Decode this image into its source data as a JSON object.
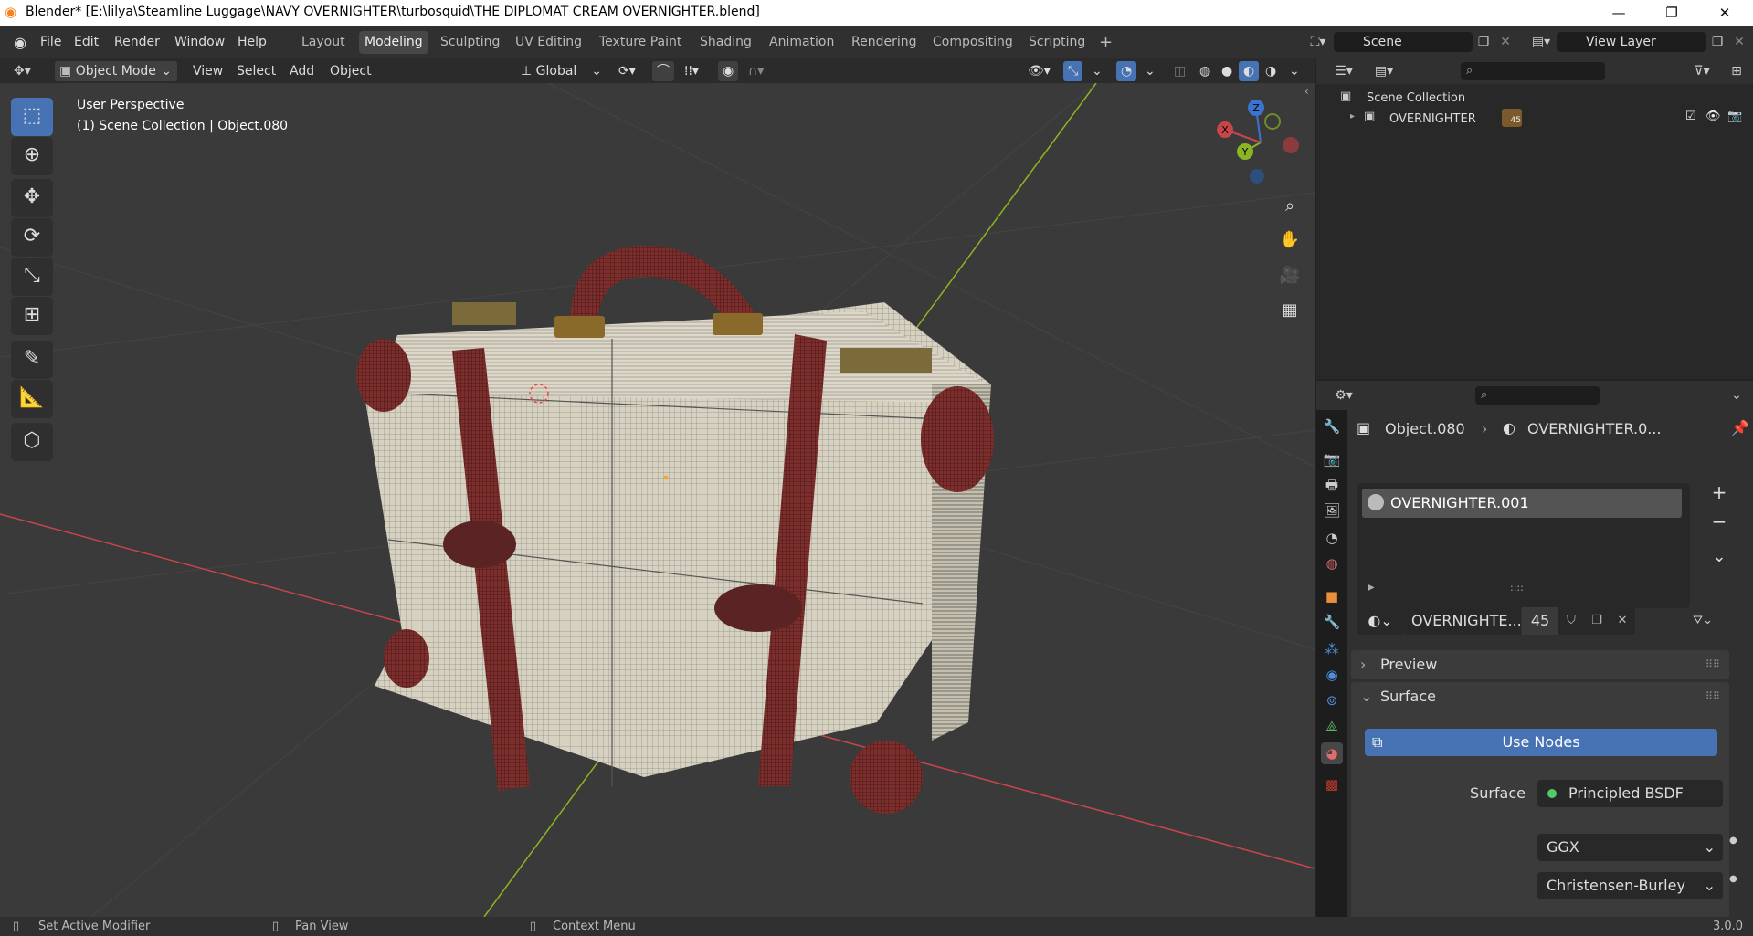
{
  "window": {
    "title": "Blender* [E:\\lilya\\Steamline Luggage\\NAVY OVERNIGHTER\\turbosquid\\THE DIPLOMAT CREAM OVERNIGHTER.blend]",
    "minimize": "—",
    "restore": "❐",
    "close": "✕"
  },
  "menu": [
    "File",
    "Edit",
    "Render",
    "Window",
    "Help"
  ],
  "workspaces": [
    "Layout",
    "Modeling",
    "Sculpting",
    "UV Editing",
    "Texture Paint",
    "Shading",
    "Animation",
    "Rendering",
    "Compositing",
    "Scripting"
  ],
  "active_workspace": "Modeling",
  "add_workspace": "+",
  "scene": {
    "label": "Scene",
    "view_layer": "View Layer"
  },
  "viewport_header": {
    "mode": "Object Mode",
    "menus": [
      "View",
      "Select",
      "Add",
      "Object"
    ],
    "orientation": "Global"
  },
  "viewport": {
    "perspective": "User Perspective",
    "collection_info": "(1) Scene Collection | Object.080",
    "gizmo": {
      "z": "Z",
      "y": "Y",
      "x": "X"
    }
  },
  "outliner": {
    "scene_collection": "Scene Collection",
    "items": [
      {
        "name": "OVERNIGHTER",
        "badge": "45"
      }
    ]
  },
  "properties": {
    "breadcrumb_object": "Object.080",
    "breadcrumb_material": "OVERNIGHTER.0...",
    "material_slot": "OVERNIGHTER.001",
    "material_name": "OVERNIGHTE...",
    "user_count": "45",
    "panels": {
      "preview": "Preview",
      "surface": "Surface"
    },
    "use_nodes": "Use Nodes",
    "surface_label": "Surface",
    "surface_value": "Principled BSDF",
    "distribution": "GGX",
    "subsurface_method": "Christensen-Burley",
    "slot_handle": "::::"
  },
  "status": {
    "left": "Set Active Modifier",
    "middle": "Pan View",
    "right": "Context Menu",
    "version": "3.0.0"
  },
  "colors": {
    "accent": "#4772b3",
    "active_tab": "#474747",
    "x_axis": "#c6464a",
    "y_axis": "#8bb522",
    "z_axis": "#3a74cf",
    "strap": "#7b2e2c",
    "case": "#d8d3c3"
  }
}
